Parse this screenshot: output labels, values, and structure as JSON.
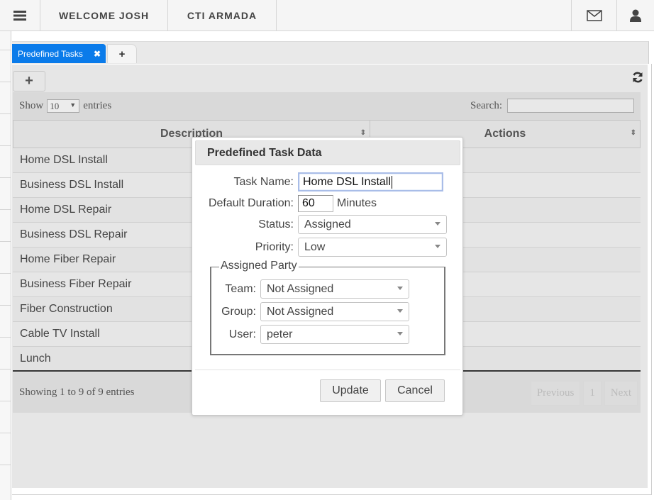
{
  "topbar": {
    "menu_icon": "hamburger-menu-icon",
    "welcome": "WELCOME JOSH",
    "company": "CTI ARMADA",
    "mail_icon": "envelope-icon",
    "user_icon": "user-icon"
  },
  "tabs": [
    {
      "label": "Predefined Tasks",
      "active": true,
      "close_glyph": "✖"
    },
    {
      "label": "+",
      "active": false
    }
  ],
  "toolbar": {
    "add_glyph": "+",
    "refresh_glyph": "⟳"
  },
  "table": {
    "length": {
      "show": "Show",
      "value": "10",
      "arrow": "▼",
      "entries": "entries"
    },
    "search": {
      "label": "Search:",
      "value": ""
    },
    "columns": [
      {
        "label": "Description",
        "sort_glyph": "⇕"
      },
      {
        "label": "Actions",
        "sort_glyph": "⇕"
      }
    ],
    "rows": [
      {
        "description": "Home DSL Install"
      },
      {
        "description": "Business DSL Install"
      },
      {
        "description": "Home DSL Repair"
      },
      {
        "description": "Business DSL Repair"
      },
      {
        "description": "Home Fiber Repair"
      },
      {
        "description": "Business Fiber Repair"
      },
      {
        "description": "Fiber Construction"
      },
      {
        "description": "Cable TV Install"
      },
      {
        "description": "Lunch"
      }
    ],
    "info": "Showing 1 to 9 of 9 entries",
    "pager": {
      "previous": "Previous",
      "page": "1",
      "next": "Next"
    }
  },
  "modal": {
    "title": "Predefined Task Data",
    "task_name": {
      "label": "Task Name:",
      "value": "Home DSL Install"
    },
    "duration": {
      "label": "Default Duration:",
      "value": "60",
      "unit": "Minutes"
    },
    "status": {
      "label": "Status:",
      "value": "Assigned"
    },
    "priority": {
      "label": "Priority:",
      "value": "Low"
    },
    "assigned_party": {
      "legend": "Assigned Party",
      "team": {
        "label": "Team:",
        "value": "Not Assigned"
      },
      "group": {
        "label": "Group:",
        "value": "Not Assigned"
      },
      "user": {
        "label": "User:",
        "value": "peter"
      }
    },
    "update_label": "Update",
    "cancel_label": "Cancel"
  },
  "colors": {
    "tab_active": "#0a7bea",
    "panel_bg": "#e6e6e6",
    "focus_border": "#a9bde8"
  }
}
